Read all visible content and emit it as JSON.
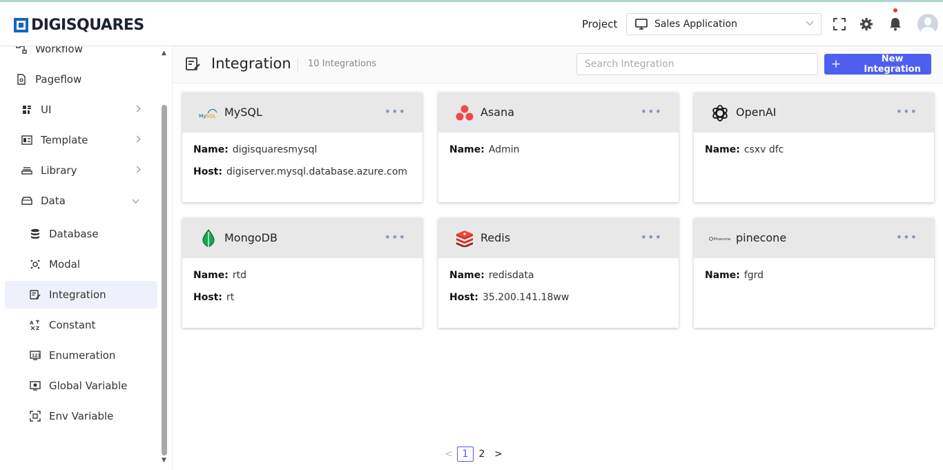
{
  "header": {
    "brand": "DIGISQUARES",
    "project_label": "Project",
    "project_value": "Sales Application"
  },
  "sidebar": {
    "items": [
      {
        "label": "Workflow"
      },
      {
        "label": "Pageflow"
      },
      {
        "label": "UI"
      },
      {
        "label": "Template"
      },
      {
        "label": "Library"
      },
      {
        "label": "Data"
      },
      {
        "label": "Database"
      },
      {
        "label": "Modal"
      },
      {
        "label": "Integration"
      },
      {
        "label": "Constant"
      },
      {
        "label": "Enumeration"
      },
      {
        "label": "Global Variable"
      },
      {
        "label": "Env Variable"
      }
    ]
  },
  "page": {
    "title": "Integration",
    "count": "10 Integrations",
    "search_placeholder": "Search Integration",
    "new_button": "New Integration"
  },
  "labels": {
    "name": "Name:",
    "host": "Host:"
  },
  "cards": [
    {
      "title": "MySQL",
      "name": "digisquaresmysql",
      "host": "digiserver.mysql.database.azure.com",
      "icon": "mysql-logo"
    },
    {
      "title": "Asana",
      "name": "Admin",
      "icon": "asana-logo"
    },
    {
      "title": "OpenAI",
      "name": "csxv dfc",
      "icon": "openai-logo"
    },
    {
      "title": "MongoDB",
      "name": "rtd",
      "host": "rt",
      "icon": "mongodb-logo"
    },
    {
      "title": "Redis",
      "name": "redisdata",
      "host": "35.200.141.18ww",
      "icon": "redis-logo"
    },
    {
      "title": "pinecone",
      "name": "fgrd",
      "icon": "pinecone-logo",
      "logo_text": "Pinecone"
    }
  ],
  "more_glyph": "•••",
  "pagination": {
    "prev": "<",
    "pages": [
      "1",
      "2"
    ],
    "next": ">",
    "current": "1"
  },
  "colors": {
    "accent": "#4d5ff0",
    "brand": "#1565c0",
    "notification": "#e53935"
  }
}
